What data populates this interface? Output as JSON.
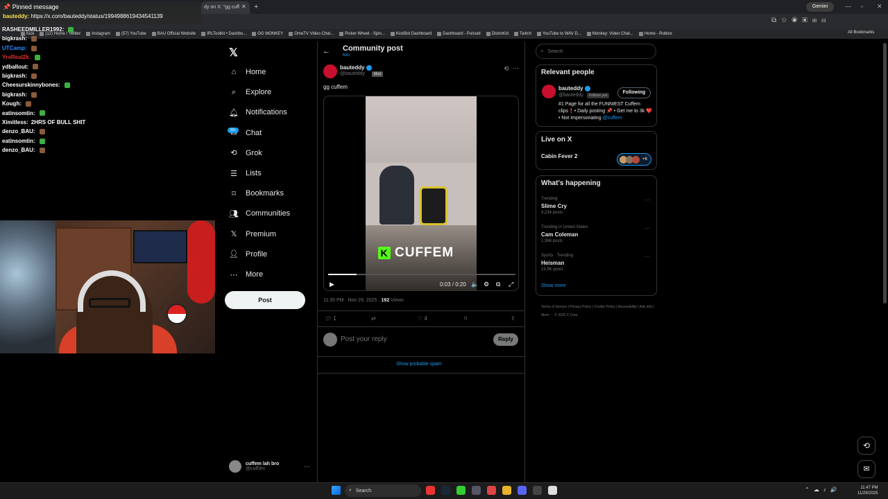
{
  "browser": {
    "active_tab_title": "dy on X: \"gg cuff",
    "gemini_label": "Gemini",
    "bookmarks": [
      "Kick",
      "(12) Home / Twitter",
      "Instagram",
      "(57) YouTube",
      "BAU Official Website",
      "IRLToolkit • Dashbo...",
      "OG MONKEY",
      "OmeTV Video Chat...",
      "Picker Wheel - Spin...",
      "KickBot Dashboard",
      "Dashboard - Pulsoid",
      "DistroKid",
      "Twitch",
      "YouTube to WAV D...",
      "Monkey: Video Chat...",
      "Home - Roblox"
    ],
    "all_bookmarks": "All Bookmarks"
  },
  "chat": {
    "pinned_title": "Pinned message",
    "pinned_user": "bauteddy",
    "pinned_text": "https://x.com/bauteddy/status/1994988619434541139",
    "messages": [
      {
        "user": "RASHEEDMILLER1992:",
        "text": "",
        "color": "#ffffff"
      },
      {
        "user": "bigkrash:",
        "text": "",
        "color": "#ffffff"
      },
      {
        "user": "UTCamp:",
        "text": "",
        "color": "#2f8cff"
      },
      {
        "user": "YrsReal2k:",
        "text": "",
        "color": "#e03030"
      },
      {
        "user": "ydballout:",
        "text": "",
        "color": "#ffffff"
      },
      {
        "user": "bigkrash:",
        "text": "",
        "color": "#ffffff"
      },
      {
        "user": "Cheesurskinnybones:",
        "text": "",
        "color": "#ffffff"
      },
      {
        "user": "bigkrash:",
        "text": "",
        "color": "#ffffff"
      },
      {
        "user": "Kough:",
        "text": "",
        "color": "#ffffff"
      },
      {
        "user": "eatinsomtin:",
        "text": "",
        "color": "#ffffff"
      },
      {
        "user": "Ximitless:",
        "text": "2HRS OF BULL SHIT",
        "color": "#ffffff"
      },
      {
        "user": "denzo_BAU:",
        "text": "",
        "color": "#ffffff"
      },
      {
        "user": "eatinsomtin:",
        "text": "",
        "color": "#ffffff"
      },
      {
        "user": "denzo_BAU:",
        "text": "",
        "color": "#ffffff"
      }
    ]
  },
  "nav": {
    "items": [
      "Home",
      "Explore",
      "Notifications",
      "Chat",
      "Grok",
      "Lists",
      "Bookmarks",
      "Communities",
      "Premium",
      "Profile",
      "More"
    ],
    "icons": [
      "home-icon",
      "search-icon",
      "bell-icon",
      "chat-icon",
      "grok-icon",
      "list-icon",
      "bookmark-icon",
      "communities-icon",
      "x-icon",
      "profile-icon",
      "more-icon"
    ],
    "post_label": "Post",
    "account_name": "cuffem lah bro",
    "account_handle": "@cuff3m"
  },
  "main": {
    "header_title": "Community post",
    "header_sub": "BAU",
    "author_name": "bauteddy",
    "author_handle": "@bauteddy",
    "mod_badge": "Mod",
    "text": "gg cuffem",
    "video_overlay": "CUFFEM",
    "video_time": "0:03 / 0:20",
    "video_progress": 0.15,
    "timestamp": "11:35 PM · Nov 29, 2025 · ",
    "views_count": "192",
    "views_label": " Views",
    "replies": "1",
    "likes": "4",
    "reply_placeholder": "Post your reply",
    "reply_button": "Reply",
    "show_spam": "Show probable spam"
  },
  "right": {
    "search_placeholder": "Search",
    "relevant_title": "Relevant people",
    "rp_name": "bauteddy",
    "rp_handle": "@bauteddy",
    "rp_follows": "Follows you",
    "rp_button": "Following",
    "rp_bio": "#1 Page for all the FUNNIEST Cuffem clips❗• Daily posting 📌 • Get me to 3k ❤️ • Not Impersonating ",
    "rp_mention": "@cuffem",
    "live_title": "Live on X",
    "live_show": "Cabin Fever 2",
    "live_count": "+6",
    "happening_title": "What's happening",
    "trends": [
      {
        "context": "Trending",
        "name": "Slime Cry",
        "count": "3,234 posts"
      },
      {
        "context": "Trending in United States",
        "name": "Cam Coleman",
        "count": "1,368 posts"
      },
      {
        "context": "Sports · Trending",
        "name": "Heisman",
        "count": "15.9K posts"
      }
    ],
    "show_more": "Show more",
    "footer": "Terms of Service  |  Privacy Policy  |  Cookie Policy  |  Accessibility  |  Ads info  |  More ···  © 2025 X Corp."
  },
  "taskbar": {
    "search": "Search",
    "time": "11:47 PM",
    "date": "11/29/2025"
  }
}
